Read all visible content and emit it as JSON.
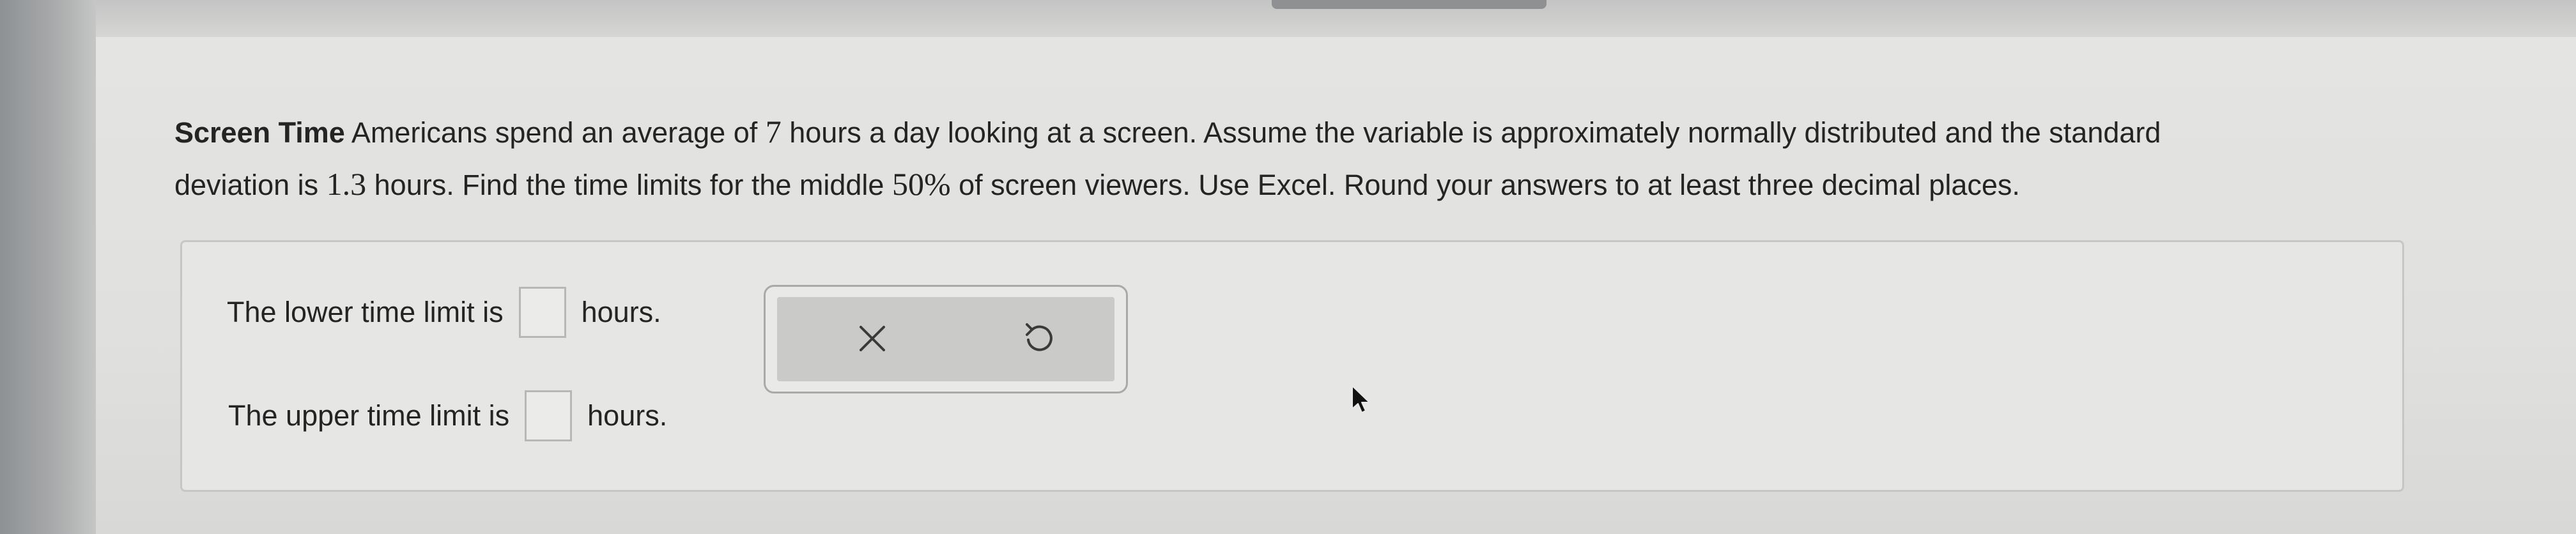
{
  "question": {
    "title": "Screen Time",
    "line1_part1": " Americans spend an average of ",
    "mean": "7",
    "line1_part2": " hours a day looking at a screen. Assume the variable is approximately normally distributed and the standard",
    "line2_part1": "deviation is ",
    "sd": "1.3",
    "line2_part2": " hours. Find the time limits for the middle ",
    "percent": "50%",
    "line2_part3": " of screen viewers. Use Excel. Round your answers to at least three decimal places."
  },
  "answers": {
    "lower_label": "The lower time limit is",
    "lower_value": "",
    "lower_unit": "hours.",
    "upper_label": "The upper time limit is",
    "upper_value": "",
    "upper_unit": "hours."
  },
  "tools": {
    "clear_icon": "x-icon",
    "undo_icon": "undo-icon"
  },
  "colors": {
    "page_background": "#e2e2e0",
    "text": "#242424",
    "panel_border": "#c6c6c4",
    "tool_bar": "#cacac9"
  }
}
